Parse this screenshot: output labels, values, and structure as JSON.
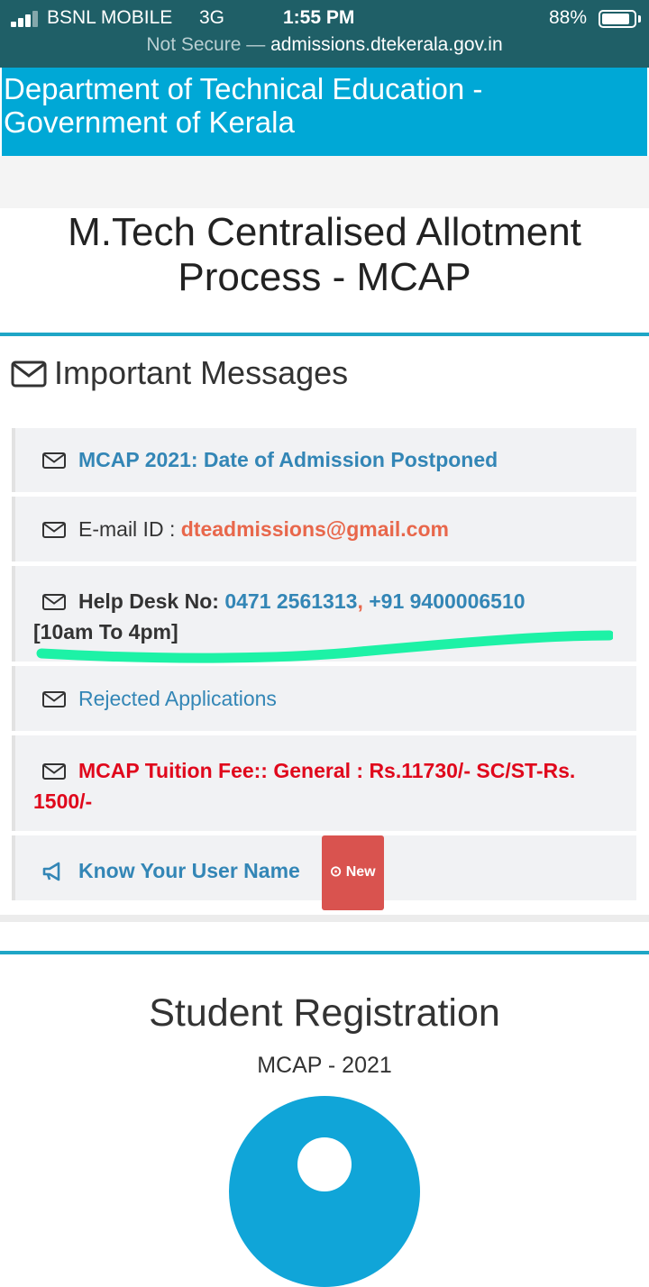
{
  "status_bar": {
    "carrier": "BSNL MOBILE",
    "network": "3G",
    "time": "1:55 PM",
    "battery_percent": "88%",
    "battery_level": 0.88
  },
  "address_bar": {
    "security": "Not Secure —",
    "host": "admissions.dtekerala.gov.in"
  },
  "header": {
    "department_line1": "Department of Technical Education -",
    "department_line2": "Government of Kerala"
  },
  "page_title": {
    "line1": "M.Tech Centralised Allotment",
    "line2": "Process - MCAP"
  },
  "messages": {
    "heading": "Important Messages",
    "items": {
      "admission": "MCAP 2021: Date of Admission Postponed",
      "email_label": "E-mail ID :",
      "email_value": "dteadmissions@gmail.com",
      "helpdesk_label": "Help Desk No:",
      "helpdesk_phone1": "0471 2561313",
      "helpdesk_sep": ",",
      "helpdesk_phone2": "+91 9400006510",
      "helpdesk_hours": "[10am To 4pm]",
      "rejected": "Rejected Applications",
      "fee": "MCAP Tuition Fee:: General : Rs.11730/- SC/ST-Rs. 1500/-",
      "username": "Know Your User Name",
      "new_badge": "New"
    }
  },
  "registration": {
    "title": "Student Registration",
    "subtitle": "MCAP - 2021"
  },
  "colors": {
    "status_bar_bg": "#1f5f67",
    "header_bg": "#00a8d6",
    "link_blue": "#3386b6",
    "email_orange": "#e8674b",
    "fee_red": "#e0081c",
    "badge_red": "#d9534f",
    "highlight_green": "#1df2a6"
  }
}
